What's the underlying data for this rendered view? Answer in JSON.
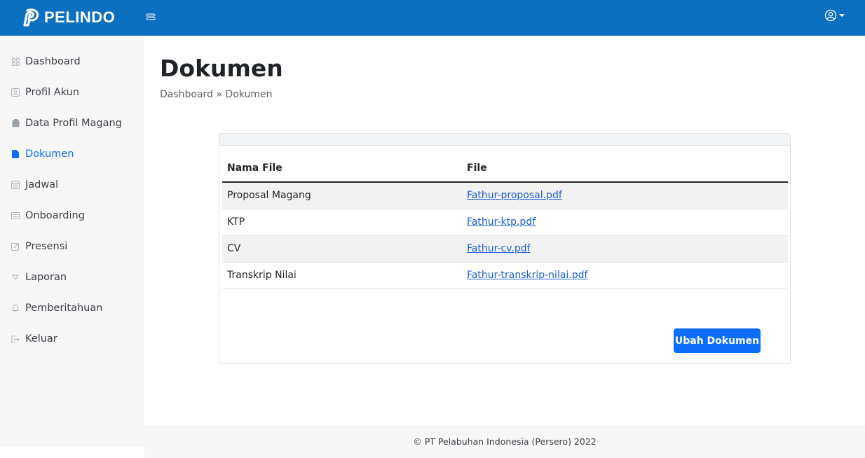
{
  "brand": {
    "name": "PELINDO",
    "color": "#0a70bf"
  },
  "header": {
    "toggle_icon": "menu-toggle-icon",
    "user_icon": "user-circle-icon"
  },
  "sidebar": {
    "items": [
      {
        "label": "Dashboard",
        "icon": "grid-icon"
      },
      {
        "label": "Profil Akun",
        "icon": "user-icon"
      },
      {
        "label": "Data Profil Magang",
        "icon": "clipboard-icon"
      },
      {
        "label": "Dokumen",
        "icon": "file-icon",
        "active": true
      },
      {
        "label": "Jadwal",
        "icon": "calendar-icon"
      },
      {
        "label": "Onboarding",
        "icon": "list-icon"
      },
      {
        "label": "Presensi",
        "icon": "edit-icon"
      },
      {
        "label": "Laporan",
        "icon": "triangle-down-icon"
      },
      {
        "label": "Pemberitahuan",
        "icon": "bell-icon"
      },
      {
        "label": "Keluar",
        "icon": "logout-icon"
      }
    ]
  },
  "main": {
    "title": "Dokumen",
    "breadcrumb": "Dashboard » Dokumen",
    "table": {
      "headers": [
        "Nama File",
        "File"
      ],
      "rows": [
        {
          "name": "Proposal Magang",
          "file": "Fathur-proposal.pdf"
        },
        {
          "name": "KTP",
          "file": "Fathur-ktp.pdf"
        },
        {
          "name": "CV",
          "file": "Fathur-cv.pdf"
        },
        {
          "name": "Transkrip Nilai",
          "file": "Fathur-transkrip-nilai.pdf"
        }
      ]
    },
    "button_label": "Ubah Dokumen",
    "accent": "#0d6efd"
  },
  "footer": {
    "text": "© PT Pelabuhan Indonesia (Persero) 2022"
  }
}
